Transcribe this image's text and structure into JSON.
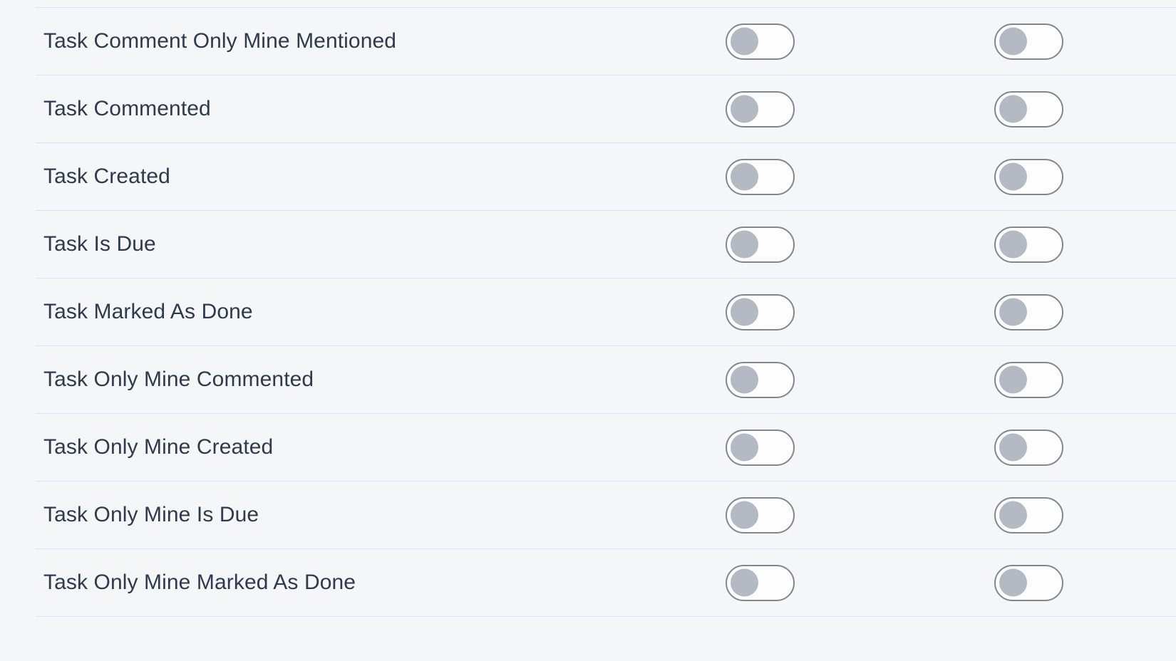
{
  "panel": {
    "name": "notification-settings-list",
    "background_color": "#f4f6f7",
    "divider_color": "#dfe3e6",
    "label_color": "#2e3a4d",
    "toggle_track_color": "#fdfdfd",
    "toggle_border_color": "#7f878f",
    "toggle_knob_color": "#b4bac4"
  },
  "columns": [
    {
      "key": "column_one",
      "state_label": "off"
    },
    {
      "key": "column_two",
      "state_label": "off"
    }
  ],
  "rows": [
    {
      "label": "Task Comment Only Mine Mentioned",
      "column_one": "off",
      "column_two": "off"
    },
    {
      "label": "Task Commented",
      "column_one": "off",
      "column_two": "off"
    },
    {
      "label": "Task Created",
      "column_one": "off",
      "column_two": "off"
    },
    {
      "label": "Task Is Due",
      "column_one": "off",
      "column_two": "off"
    },
    {
      "label": "Task Marked As Done",
      "column_one": "off",
      "column_two": "off"
    },
    {
      "label": "Task Only Mine Commented",
      "column_one": "off",
      "column_two": "off"
    },
    {
      "label": "Task Only Mine Created",
      "column_one": "off",
      "column_two": "off"
    },
    {
      "label": "Task Only Mine Is Due",
      "column_one": "off",
      "column_two": "off"
    },
    {
      "label": "Task Only Mine Marked As Done",
      "column_one": "off",
      "column_two": "off"
    }
  ]
}
